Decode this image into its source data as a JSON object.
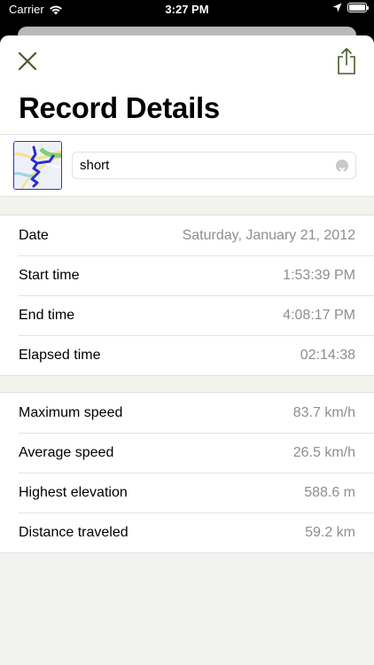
{
  "status_bar": {
    "carrier": "Carrier",
    "time": "3:27 PM",
    "icons": [
      "wifi-icon",
      "location-arrow-icon",
      "battery-icon"
    ]
  },
  "header": {
    "title": "Record Details",
    "close_icon": "close-x-icon",
    "share_icon": "share-icon"
  },
  "record": {
    "name_value": "short",
    "thumbnail": "route-map-thumbnail"
  },
  "time_details": [
    {
      "label": "Date",
      "value": "Saturday, January 21, 2012"
    },
    {
      "label": "Start time",
      "value": "1:53:39 PM"
    },
    {
      "label": "End time",
      "value": "4:08:17 PM"
    },
    {
      "label": "Elapsed time",
      "value": "02:14:38"
    }
  ],
  "stats_details": [
    {
      "label": "Maximum speed",
      "value": "83.7 km/h"
    },
    {
      "label": "Average speed",
      "value": "26.5 km/h"
    },
    {
      "label": "Highest elevation",
      "value": "588.6 m"
    },
    {
      "label": "Distance traveled",
      "value": "59.2 km"
    }
  ],
  "colors": {
    "accent": "#4a5a2a",
    "value_text": "#8e8e93",
    "background": "#f2f2ef",
    "route_line": "#2b2fd0"
  }
}
